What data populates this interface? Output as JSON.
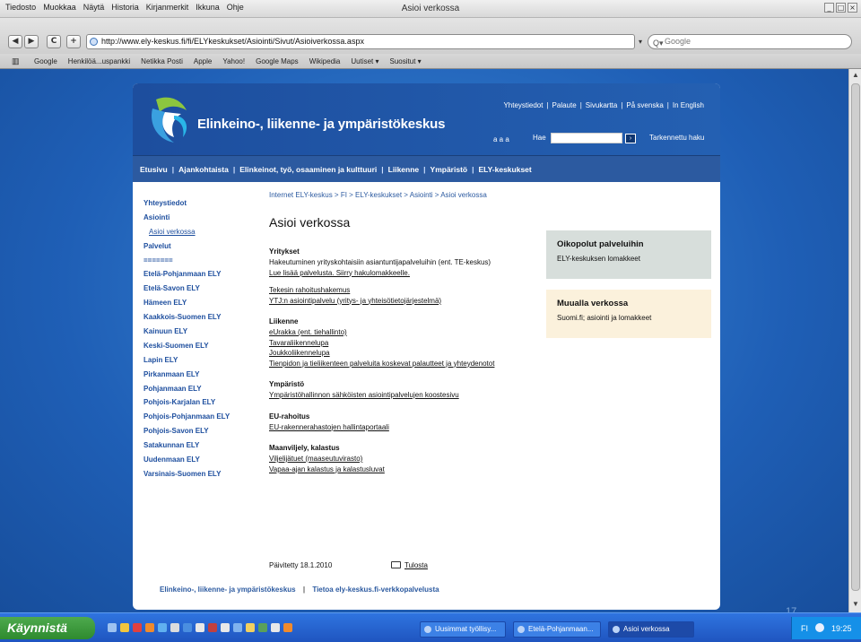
{
  "window": {
    "title": "Asioi verkossa",
    "menu": [
      "Tiedosto",
      "Muokkaa",
      "Näytä",
      "Historia",
      "Kirjanmerkit",
      "Ikkuna",
      "Ohje"
    ]
  },
  "toolbar": {
    "back": "◀",
    "forward": "▶",
    "reload": "C",
    "add": "+",
    "url": "http://www.ely-keskus.fi/fi/ELYkeskukset/Asiointi/Sivut/Asioiverkossa.aspx",
    "search_placeholder": "Google"
  },
  "bookmarks": [
    "Google",
    "Henkilöä...uspankki",
    "Netikka Posti",
    "Apple",
    "Yahoo!",
    "Google Maps",
    "Wikipedia",
    "Uutiset ▾",
    "Suositut ▾"
  ],
  "header": {
    "site_name": "Elinkeino-, liikenne- ja ympäristökeskus",
    "top_links": [
      "Yhteystiedot",
      "|",
      "Palaute",
      "|",
      "Sivukartta",
      "|",
      "På svenska",
      "|",
      "In English"
    ],
    "font_size": "a a a",
    "search_label": "Hae",
    "search_button": "›",
    "advanced_search": "Tarkennettu haku"
  },
  "nav": [
    "Etusivu",
    "Ajankohtaista",
    "Elinkeinot, työ, osaaminen ja kulttuuri",
    "Liikenne",
    "Ympäristö",
    "ELY-keskukset"
  ],
  "left_nav": [
    {
      "label": "Yhteystiedot",
      "sub": false
    },
    {
      "label": "Asiointi",
      "sub": false
    },
    {
      "label": "Asioi verkossa",
      "sub": true
    },
    {
      "label": "Palvelut",
      "sub": false
    },
    {
      "label": "=======",
      "sub": false
    },
    {
      "label": "Etelä-Pohjanmaan ELY",
      "sub": false
    },
    {
      "label": "Etelä-Savon ELY",
      "sub": false
    },
    {
      "label": "Hämeen ELY",
      "sub": false
    },
    {
      "label": "Kaakkois-Suomen ELY",
      "sub": false
    },
    {
      "label": "Kainuun ELY",
      "sub": false
    },
    {
      "label": "Keski-Suomen ELY",
      "sub": false
    },
    {
      "label": "Lapin ELY",
      "sub": false
    },
    {
      "label": "Pirkanmaan ELY",
      "sub": false
    },
    {
      "label": "Pohjanmaan ELY",
      "sub": false
    },
    {
      "label": "Pohjois-Karjalan ELY",
      "sub": false
    },
    {
      "label": "Pohjois-Pohjanmaan ELY",
      "sub": false
    },
    {
      "label": "Pohjois-Savon ELY",
      "sub": false
    },
    {
      "label": "Satakunnan ELY",
      "sub": false
    },
    {
      "label": "Uudenmaan ELY",
      "sub": false
    },
    {
      "label": "Varsinais-Suomen ELY",
      "sub": false
    }
  ],
  "breadcrumb": "Internet ELY-keskus > FI > ELY-keskukset > Asiointi > Asioi verkossa",
  "page_title": "Asioi verkossa",
  "sections": [
    {
      "title": "Yritykset",
      "lines": [
        {
          "text": "Hakeutuminen yrityskohtaisiin asiantuntijapalveluihin (ent. TE-keskus)",
          "link": false
        },
        {
          "text": "Lue lisää palvelusta. Siirry hakulomakkeelle.",
          "link": true
        },
        {
          "text": "",
          "link": false
        },
        {
          "text": "Tekesin rahoitushakemus",
          "link": true
        },
        {
          "text": "YTJ:n asiointipalvelu (yritys- ja yhteisötietojärjestelmä)",
          "link": true
        }
      ]
    },
    {
      "title": "Liikenne",
      "lines": [
        {
          "text": "eUrakka (ent. tiehallinto)",
          "link": true
        },
        {
          "text": "Tavaraliikennelupa",
          "link": true
        },
        {
          "text": "Joukkoliikennelupa",
          "link": true
        },
        {
          "text": "Tienpidon ja tieliikenteen palveluita koskevat palautteet ja yhteydenotot",
          "link": true
        }
      ]
    },
    {
      "title": "Ympäristö",
      "lines": [
        {
          "text": "Ympäristöhallinnon sähköisten asiointipalvelujen koostesivu",
          "link": true
        }
      ]
    },
    {
      "title": "EU-rahoitus",
      "lines": [
        {
          "text": "EU-rakennerahastojen hallintaportaali",
          "link": true
        }
      ]
    },
    {
      "title": "Maanviljely, kalastus",
      "lines": [
        {
          "text": "Viljelijätuet (maaseutuvirasto)",
          "link": true
        },
        {
          "text": "Vapaa-ajan kalastus ja kalastusluvat",
          "link": true
        }
      ]
    }
  ],
  "box1": {
    "title": "Oikopolut palveluihin",
    "text": "ELY-keskuksen lomakkeet"
  },
  "box2": {
    "title": "Muualla verkossa",
    "text": "Suomi.fi; asiointi ja lomakkeet"
  },
  "updated": "Päivitetty 18.1.2010",
  "print": "Tulosta",
  "footer": {
    "left": "Elinkeino-, liikenne- ja ympäristökeskus",
    "sep": "|",
    "right": "Tietoa ely-keskus.fi-verkkopalvelusta"
  },
  "slide_number": "17",
  "taskbar": {
    "start": "Käynnistä",
    "tasks": [
      "Uusimmat työllisy...",
      "Etelä-Pohjanmaan...",
      "Asioi verkossa"
    ],
    "lang": "FI",
    "clock": "19:25"
  }
}
